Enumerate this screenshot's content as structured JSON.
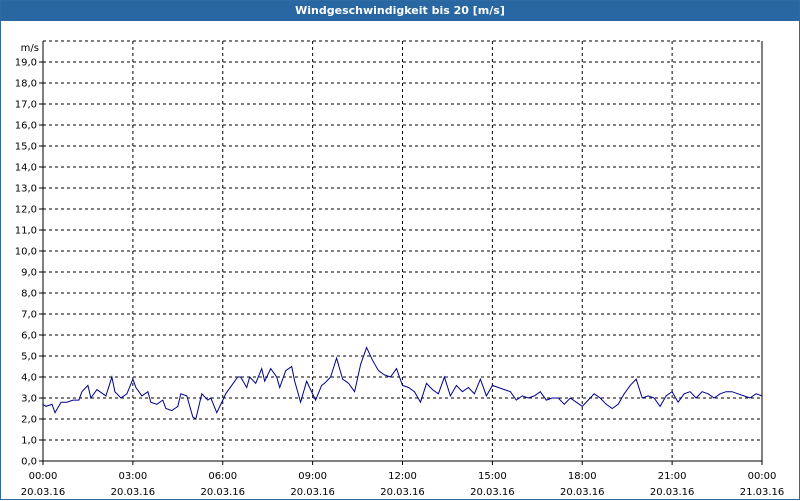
{
  "window": {
    "title": "Windgeschwindigkeit bis 20 [m/s]"
  },
  "chart_data": {
    "type": "line",
    "title": "Windgeschwindigkeit bis 20 [m/s]",
    "ylabel": "m/s",
    "xlabel": "",
    "ylim": [
      0,
      20
    ],
    "xlim_hours": [
      0,
      24
    ],
    "y_ticks": [
      "0,0",
      "1,0",
      "2,0",
      "3,0",
      "4,0",
      "5,0",
      "6,0",
      "7,0",
      "8,0",
      "9,0",
      "10,0",
      "11,0",
      "12,0",
      "13,0",
      "14,0",
      "15,0",
      "16,0",
      "17,0",
      "18,0",
      "19,0"
    ],
    "x_ticks": [
      {
        "time": "00:00",
        "date": "20.03.16"
      },
      {
        "time": "03:00",
        "date": "20.03.16"
      },
      {
        "time": "06:00",
        "date": "20.03.16"
      },
      {
        "time": "09:00",
        "date": "20.03.16"
      },
      {
        "time": "12:00",
        "date": "20.03.16"
      },
      {
        "time": "15:00",
        "date": "20.03.16"
      },
      {
        "time": "18:00",
        "date": "20.03.16"
      },
      {
        "time": "21:00",
        "date": "20.03.16"
      },
      {
        "time": "00:00",
        "date": "21.03.16"
      }
    ],
    "grid": true,
    "line_color": "#00008b",
    "series": [
      {
        "x_hours": [
          0.0,
          0.1,
          0.3,
          0.4,
          0.6,
          0.8,
          1.0,
          1.2,
          1.3,
          1.5,
          1.6,
          1.8,
          2.0,
          2.1,
          2.3,
          2.4,
          2.6,
          2.8,
          3.0,
          3.1,
          3.3,
          3.5,
          3.6,
          3.8,
          4.0,
          4.1,
          4.3,
          4.5,
          4.6,
          4.8,
          5.0,
          5.1,
          5.3,
          5.5,
          5.6,
          5.8,
          6.0,
          6.1,
          6.3,
          6.5,
          6.6,
          6.8,
          6.9,
          7.1,
          7.3,
          7.4,
          7.6,
          7.8,
          7.9,
          8.1,
          8.3,
          8.4,
          8.6,
          8.8,
          8.9,
          9.1,
          9.3,
          9.4,
          9.6,
          9.8,
          10.0,
          10.2,
          10.4,
          10.6,
          10.8,
          11.0,
          11.2,
          11.4,
          11.6,
          11.8,
          12.0,
          12.2,
          12.4,
          12.6,
          12.8,
          13.0,
          13.2,
          13.4,
          13.6,
          13.8,
          14.0,
          14.2,
          14.4,
          14.6,
          14.8,
          15.0,
          15.2,
          15.4,
          15.6,
          15.8,
          16.0,
          16.2,
          16.4,
          16.6,
          16.8,
          17.0,
          17.2,
          17.4,
          17.6,
          17.8,
          18.0,
          18.2,
          18.4,
          18.6,
          18.8,
          19.0,
          19.2,
          19.4,
          19.6,
          19.8,
          20.0,
          20.2,
          20.4,
          20.6,
          20.8,
          21.0,
          21.2,
          21.4,
          21.6,
          21.8,
          22.0,
          22.2,
          22.4,
          22.6,
          22.8,
          23.0,
          23.2,
          23.4,
          23.6,
          23.8,
          24.0
        ],
        "values": [
          2.7,
          2.6,
          2.7,
          2.3,
          2.8,
          2.8,
          2.9,
          2.9,
          3.3,
          3.6,
          3.0,
          3.4,
          3.2,
          3.1,
          4.0,
          3.3,
          3.0,
          3.2,
          3.9,
          3.5,
          3.1,
          3.3,
          2.8,
          2.7,
          2.9,
          2.5,
          2.4,
          2.6,
          3.2,
          3.1,
          2.1,
          2.0,
          3.2,
          2.9,
          3.0,
          2.3,
          2.9,
          3.2,
          3.6,
          4.0,
          4.0,
          3.5,
          4.0,
          3.7,
          4.4,
          3.8,
          4.4,
          4.0,
          3.5,
          4.3,
          4.5,
          3.8,
          2.8,
          3.8,
          3.5,
          2.9,
          3.6,
          3.7,
          4.0,
          4.9,
          3.9,
          3.7,
          3.3,
          4.6,
          5.4,
          4.8,
          4.3,
          4.1,
          4.0,
          4.4,
          3.6,
          3.5,
          3.3,
          2.8,
          3.7,
          3.4,
          3.2,
          4.0,
          3.1,
          3.6,
          3.3,
          3.5,
          3.2,
          3.9,
          3.1,
          3.6,
          3.5,
          3.4,
          3.3,
          2.9,
          3.1,
          3.0,
          3.1,
          3.3,
          2.9,
          3.0,
          3.0,
          2.7,
          3.0,
          2.8,
          2.6,
          2.9,
          3.2,
          3.0,
          2.7,
          2.5,
          2.7,
          3.2,
          3.6,
          3.9,
          3.0,
          3.1,
          3.0,
          2.6,
          3.1,
          3.3,
          2.8,
          3.2,
          3.3,
          3.0,
          3.3,
          3.2,
          3.0,
          3.2,
          3.3,
          3.3,
          3.2,
          3.1,
          3.0,
          3.2,
          3.1
        ]
      }
    ]
  }
}
